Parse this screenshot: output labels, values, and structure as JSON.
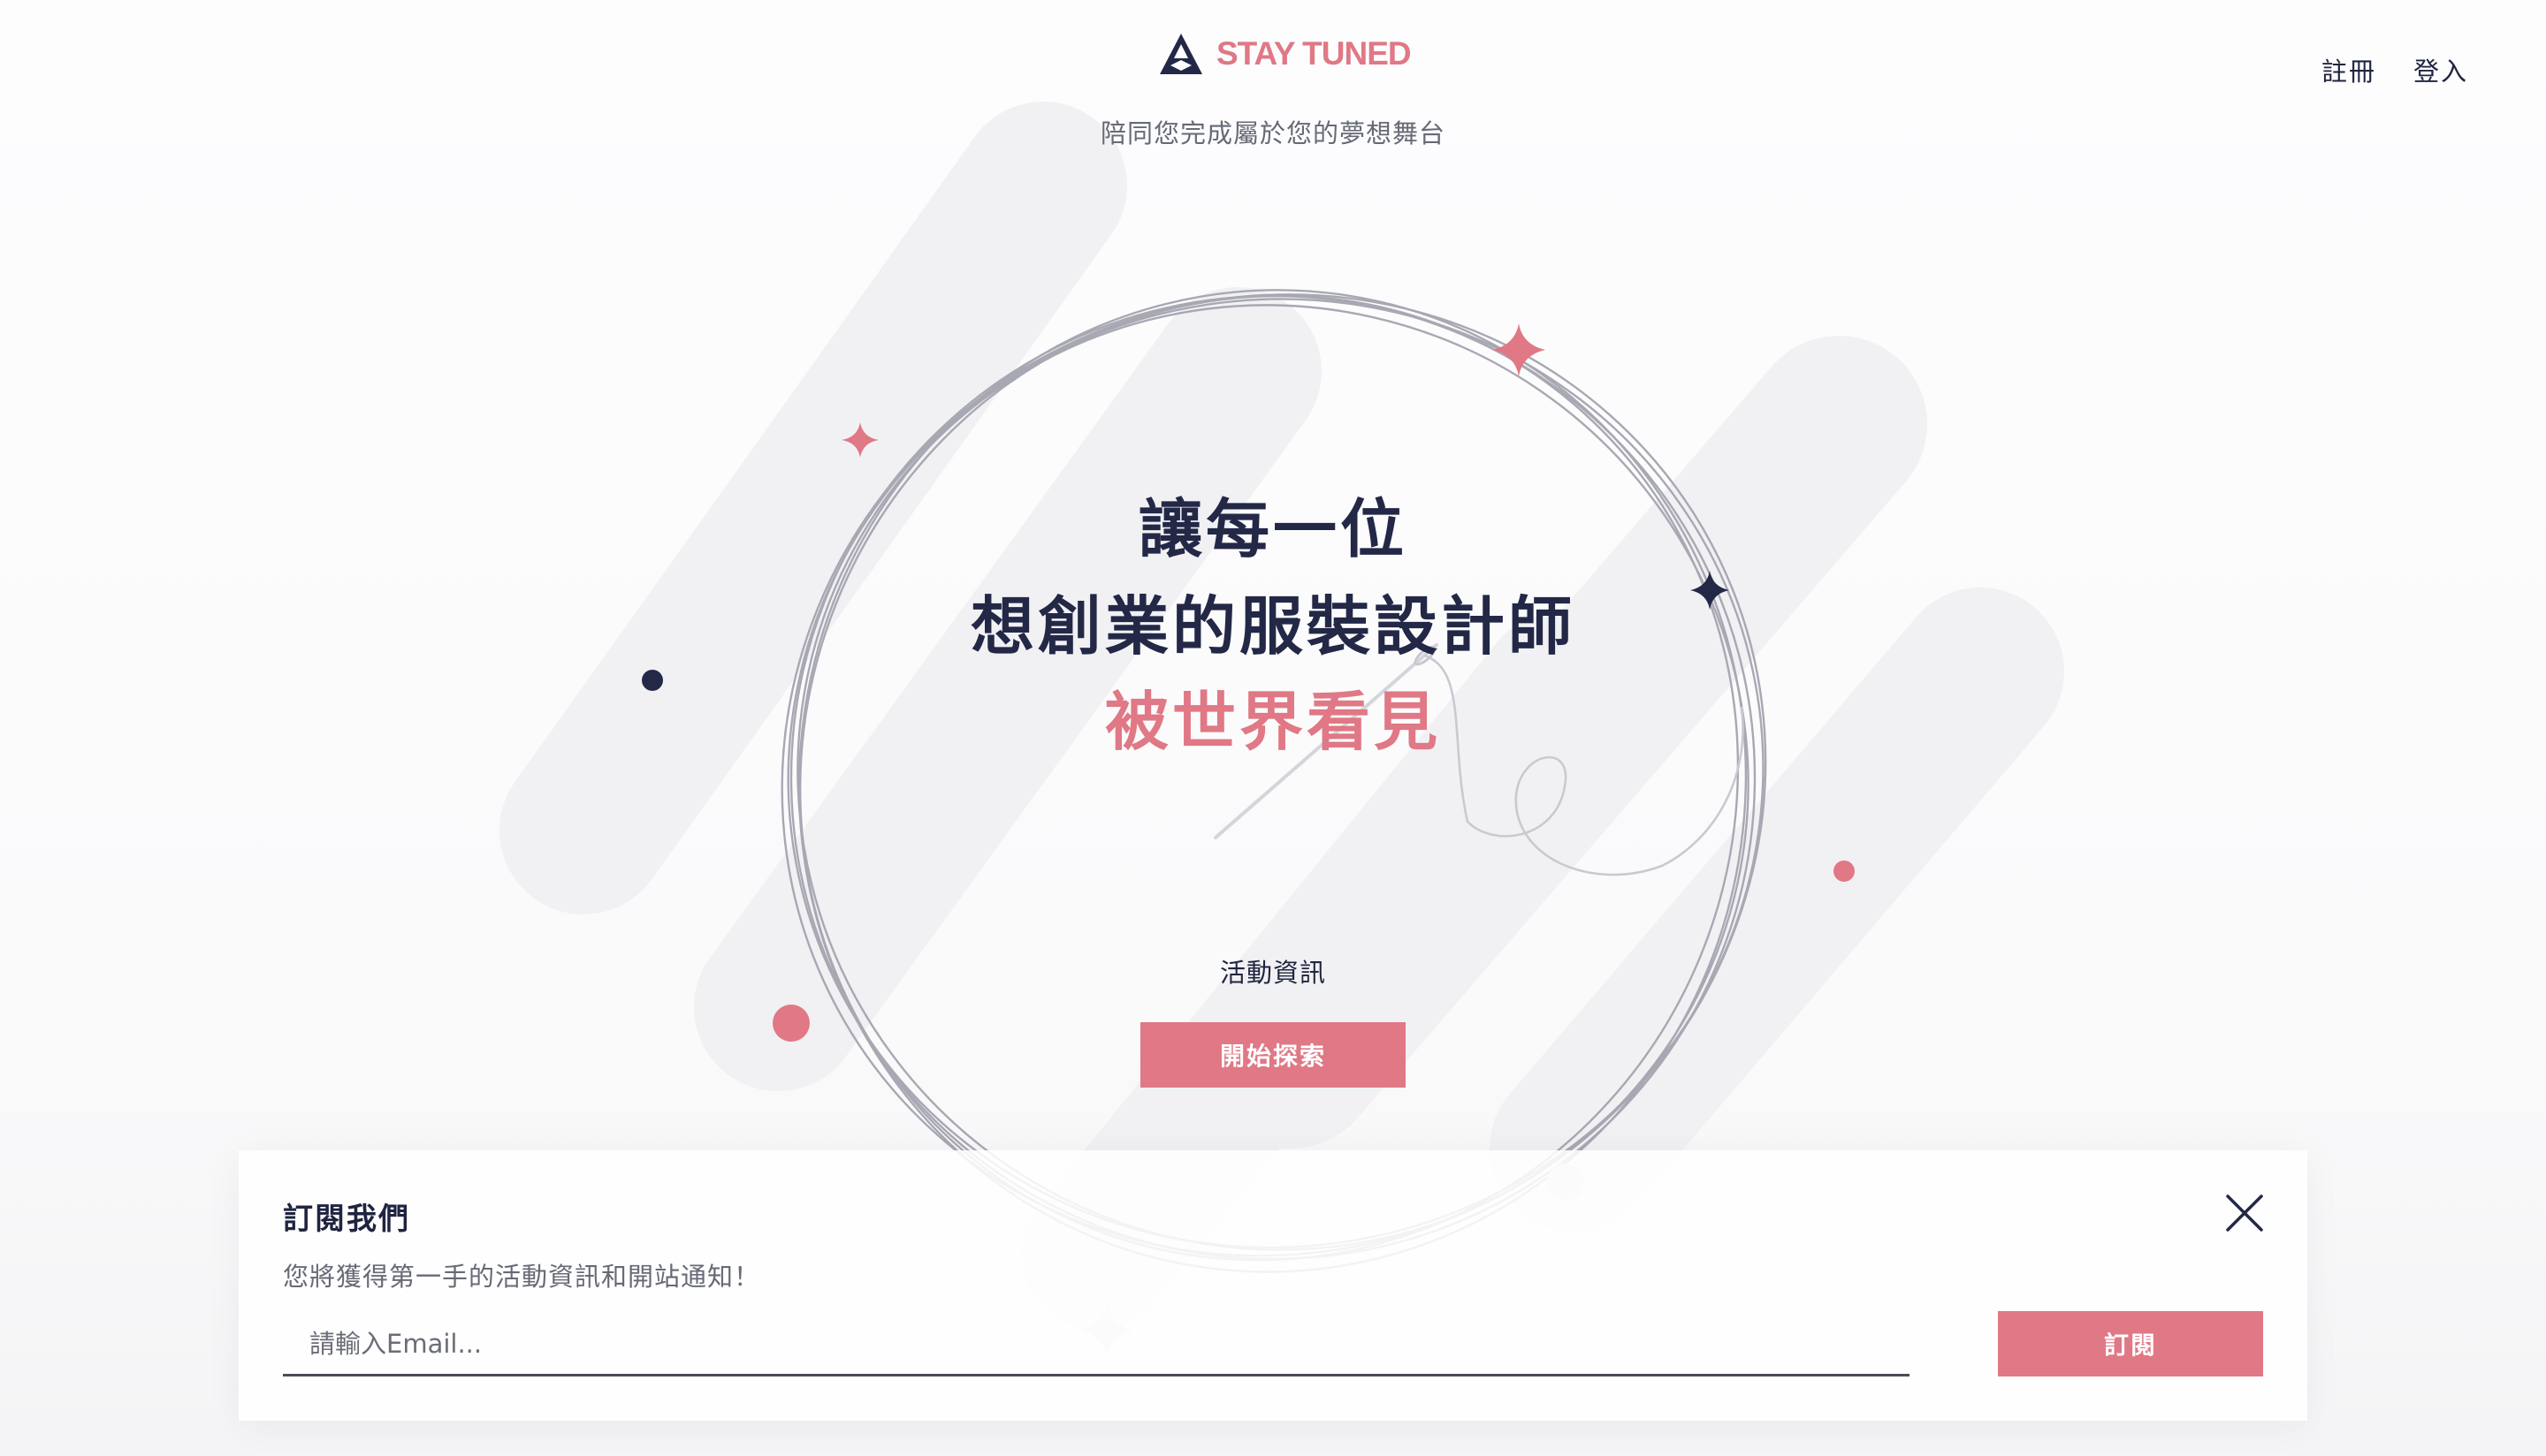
{
  "brand": {
    "name": "STAY TUNED",
    "tagline": "陪同您完成屬於您的夢想舞台"
  },
  "nav": {
    "register": "註冊",
    "login": "登入"
  },
  "hero": {
    "line1": "讓每一位",
    "line2": "想創業的服裝設計師",
    "line3": "被世界看見"
  },
  "event": {
    "label": "活動資訊",
    "button": "開始探索"
  },
  "subscribe": {
    "title": "訂閱我們",
    "description": "您將獲得第一手的活動資訊和開站通知！",
    "email_placeholder": "請輸入Email...",
    "button": "訂閱"
  },
  "colors": {
    "accent": "#e07885",
    "navy": "#232847",
    "background": "#fcfcfd",
    "muted_text": "#666a75"
  },
  "icons": {
    "logo": "triangle-mountain-logo",
    "close": "close-icon"
  }
}
